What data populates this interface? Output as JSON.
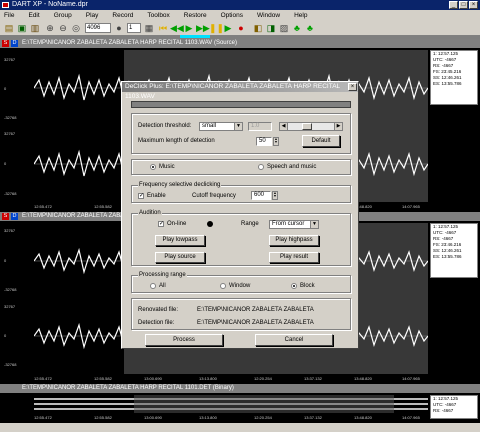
{
  "app": {
    "title": "DART XP - NoName.dpr"
  },
  "menu": [
    "File",
    "Edit",
    "Group",
    "Play",
    "Record",
    "Toolbox",
    "Restore",
    "Options",
    "Window",
    "Help"
  ],
  "toolbar": {
    "rate_value": "4096",
    "count_value": "1"
  },
  "track1": {
    "title": "E:\\TEMP\\NICANOR ZABALETA ZABALETA HARP RECITAL 1103.WAV (Source)",
    "s_label": "S",
    "d_label": "D",
    "y_labels": [
      "32767",
      "0",
      "-32768",
      "32767",
      "0",
      "-32768"
    ],
    "time_labels": [
      "12:55.472",
      "12:55.582",
      "13:00.690",
      "13:13.800",
      "12:20.254",
      "13:37.132",
      "13:48.820",
      "14:07.965"
    ],
    "info": [
      "1: 12:57.125",
      "UTC: -4667",
      "RS: -4667",
      "",
      "FS: 23:45.216",
      "SS: 12:46.261",
      "ES: 13:55.786"
    ]
  },
  "track2": {
    "title": "E:\\TEMP\\NICANOR ZABALETA ZABALETA HARP RECITAL 1103.WAV (Result)",
    "s_label": "S",
    "d_label": "D",
    "y_labels": [
      "32767",
      "0",
      "-32768",
      "32767",
      "0",
      "-32768"
    ],
    "time_labels": [
      "12:55.472",
      "12:55.582",
      "13:00.690",
      "13:13.800",
      "12:20.254",
      "13:37.132",
      "13:48.820",
      "14:07.965"
    ],
    "info": [
      "1: 12:57.125",
      "UTC: -4667",
      "RS: -4667",
      "",
      "FS: 23:46.216",
      "SS: 12:46.261",
      "ES: 13:55.786"
    ]
  },
  "track3": {
    "title": "E:\\TEMP\\NICANOR ZABALETA ZABALETA HARP RECITAL 1101.DET (Binary)",
    "time_labels": [
      "12:55.472",
      "12:55.582",
      "13:00.690",
      "13:13.800",
      "12:20.254",
      "13:37.132",
      "13:48.820",
      "14:07.965"
    ],
    "info": [
      "1: 12:57.125",
      "UTC: -4667",
      "RS: -4667"
    ]
  },
  "dialog": {
    "title": "DeClick Plus: E:\\TEMP\\NICANOR ZABALETA ZABALETA HARP RECITAL 1103.WAV",
    "detection_threshold_label": "Detection threshold:",
    "detection_threshold_value": "small",
    "threshold_number": "1.0",
    "max_length_label": "Maximum length of detection",
    "max_length_value": "50",
    "default_button": "Default",
    "music_label": "Music",
    "speech_label": "Speech and music",
    "freq_group_label": "Frequency selective declicking",
    "enable_label": "Enable",
    "cutoff_label": "Cutoff frequency",
    "cutoff_value": "600",
    "audition_label": "Audition",
    "online_label": "On-line",
    "range_label": "Range",
    "range_value": "From cursor",
    "play_lowpass": "Play lowpass",
    "play_highpass": "Play highpass",
    "play_source": "Play source",
    "play_result": "Play result",
    "processing_range_label": "Processing range",
    "all_label": "All",
    "window_label": "Window",
    "block_label": "Block",
    "renovated_label": "Renovated file:",
    "renovated_value": "E:\\TEMP\\NICANOR ZABALETA ZABALETA",
    "detection_file_label": "Detection file:",
    "detection_file_value": "E:\\TEMP\\NICANOR ZABALETA ZABALETA",
    "process_button": "Process",
    "cancel_button": "Cancel"
  }
}
